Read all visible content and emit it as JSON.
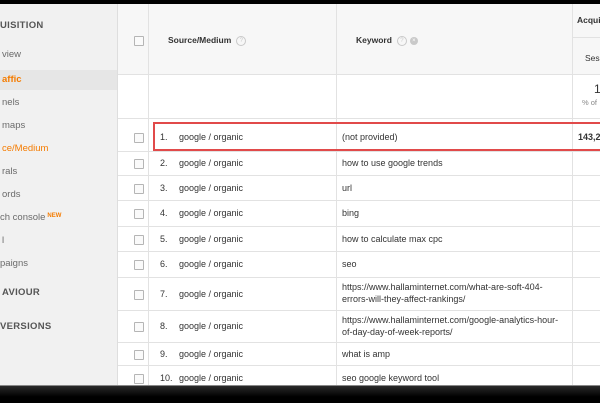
{
  "sidebar": {
    "items": [
      {
        "label": "UISITION",
        "kind": "section"
      },
      {
        "label": "view",
        "kind": "item"
      },
      {
        "label": "affic",
        "kind": "active"
      },
      {
        "label": "nels",
        "kind": "item"
      },
      {
        "label": "maps",
        "kind": "item"
      },
      {
        "label": "ce/Medium",
        "kind": "active"
      },
      {
        "label": "rals",
        "kind": "item"
      },
      {
        "label": "ords",
        "kind": "item"
      },
      {
        "label": "ch console",
        "kind": "item",
        "badge": "NEW"
      },
      {
        "label": "l",
        "kind": "item"
      },
      {
        "label": "paigns",
        "kind": "item"
      },
      {
        "label": "AVIOUR",
        "kind": "section"
      },
      {
        "label": "VERSIONS",
        "kind": "section"
      }
    ]
  },
  "table": {
    "headers": {
      "source_medium": "Source/Medium",
      "keyword": "Keyword",
      "acquisition": "Acquis",
      "sessions": "Sess"
    },
    "totals": {
      "value": "1",
      "pct": "% of"
    },
    "rows": [
      {
        "num": "1.",
        "source": "google / organic",
        "keyword": "(not provided)",
        "sessions": "143,2"
      },
      {
        "num": "2.",
        "source": "google / organic",
        "keyword": "how to use google trends",
        "sessions": ""
      },
      {
        "num": "3.",
        "source": "google / organic",
        "keyword": "url",
        "sessions": ""
      },
      {
        "num": "4.",
        "source": "google / organic",
        "keyword": "bing",
        "sessions": ""
      },
      {
        "num": "5.",
        "source": "google / organic",
        "keyword": "how to calculate max cpc",
        "sessions": ""
      },
      {
        "num": "6.",
        "source": "google / organic",
        "keyword": "seo",
        "sessions": ""
      },
      {
        "num": "7.",
        "source": "google / organic",
        "keyword": "https://www.hallaminternet.com/what-are-soft-404-errors-will-they-affect-rankings/",
        "sessions": ""
      },
      {
        "num": "8.",
        "source": "google / organic",
        "keyword": "https://www.hallaminternet.com/google-analytics-hour-of-day-day-of-week-reports/",
        "sessions": ""
      },
      {
        "num": "9.",
        "source": "google / organic",
        "keyword": "what is amp",
        "sessions": ""
      },
      {
        "num": "10.",
        "source": "google / organic",
        "keyword": "seo google keyword tool",
        "sessions": ""
      }
    ]
  },
  "colors": {
    "accent": "#f57c00",
    "highlight_border": "#e14a4a"
  }
}
